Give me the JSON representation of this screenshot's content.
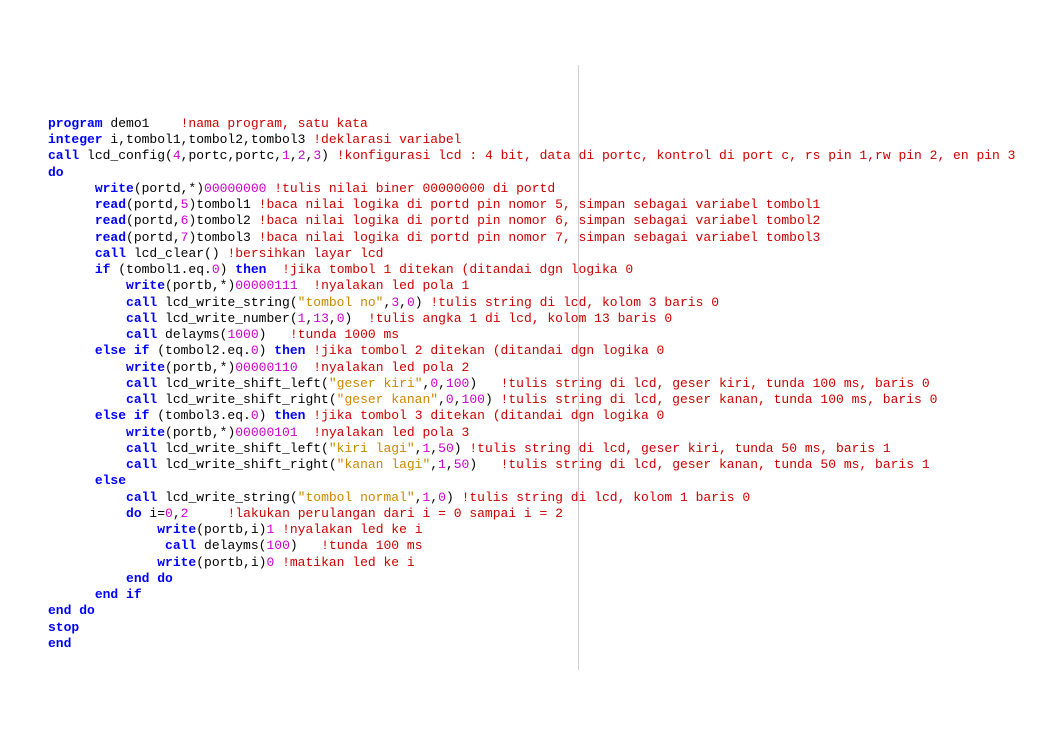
{
  "code": {
    "lines": [
      {
        "indent": 0,
        "tokens": [
          {
            "t": "kw",
            "v": "program"
          },
          {
            "t": "id",
            "v": " demo1    "
          },
          {
            "t": "cm",
            "v": "!nama program, satu kata"
          }
        ]
      },
      {
        "indent": 0,
        "tokens": [
          {
            "t": "kw",
            "v": "integer"
          },
          {
            "t": "id",
            "v": " i,tombol1,tombol2,tombol3 "
          },
          {
            "t": "cm",
            "v": "!deklarasi variabel"
          }
        ]
      },
      {
        "indent": 0,
        "tokens": [
          {
            "t": "kw",
            "v": "call"
          },
          {
            "t": "id",
            "v": " lcd_config("
          },
          {
            "t": "nm",
            "v": "4"
          },
          {
            "t": "id",
            "v": ",portc,portc,"
          },
          {
            "t": "nm",
            "v": "1"
          },
          {
            "t": "id",
            "v": ","
          },
          {
            "t": "nm",
            "v": "2"
          },
          {
            "t": "id",
            "v": ","
          },
          {
            "t": "nm",
            "v": "3"
          },
          {
            "t": "id",
            "v": ") "
          },
          {
            "t": "cm",
            "v": "!konfigurasi lcd : 4 bit, data di portc, kontrol di port c, rs pin 1,rw pin 2, en pin 3"
          }
        ]
      },
      {
        "indent": 0,
        "tokens": [
          {
            "t": "kw",
            "v": "do"
          }
        ]
      },
      {
        "indent": 6,
        "tokens": [
          {
            "t": "kw",
            "v": "write"
          },
          {
            "t": "id",
            "v": "(portd,*)"
          },
          {
            "t": "nm",
            "v": "00000000"
          },
          {
            "t": "id",
            "v": " "
          },
          {
            "t": "cm",
            "v": "!tulis nilai biner 00000000 di portd"
          }
        ]
      },
      {
        "indent": 6,
        "tokens": [
          {
            "t": "kw",
            "v": "read"
          },
          {
            "t": "id",
            "v": "(portd,"
          },
          {
            "t": "nm",
            "v": "5"
          },
          {
            "t": "id",
            "v": ")tombol1 "
          },
          {
            "t": "cm",
            "v": "!baca nilai logika di portd pin nomor 5, simpan sebagai variabel tombol1"
          }
        ]
      },
      {
        "indent": 6,
        "tokens": [
          {
            "t": "kw",
            "v": "read"
          },
          {
            "t": "id",
            "v": "(portd,"
          },
          {
            "t": "nm",
            "v": "6"
          },
          {
            "t": "id",
            "v": ")tombol2 "
          },
          {
            "t": "cm",
            "v": "!baca nilai logika di portd pin nomor 6, simpan sebagai variabel tombol2"
          }
        ]
      },
      {
        "indent": 6,
        "tokens": [
          {
            "t": "kw",
            "v": "read"
          },
          {
            "t": "id",
            "v": "(portd,"
          },
          {
            "t": "nm",
            "v": "7"
          },
          {
            "t": "id",
            "v": ")tombol3 "
          },
          {
            "t": "cm",
            "v": "!baca nilai logika di portd pin nomor 7, simpan sebagai variabel tombol3"
          }
        ]
      },
      {
        "indent": 6,
        "tokens": [
          {
            "t": "kw",
            "v": "call"
          },
          {
            "t": "id",
            "v": " lcd_clear() "
          },
          {
            "t": "cm",
            "v": "!bersihkan layar lcd"
          }
        ]
      },
      {
        "indent": 6,
        "tokens": [
          {
            "t": "kw",
            "v": "if"
          },
          {
            "t": "id",
            "v": " (tombol1.eq."
          },
          {
            "t": "nm",
            "v": "0"
          },
          {
            "t": "id",
            "v": ") "
          },
          {
            "t": "kw",
            "v": "then"
          },
          {
            "t": "id",
            "v": "  "
          },
          {
            "t": "cm",
            "v": "!jika tombol 1 ditekan (ditandai dgn logika 0"
          }
        ]
      },
      {
        "indent": 10,
        "tokens": [
          {
            "t": "kw",
            "v": "write"
          },
          {
            "t": "id",
            "v": "(portb,*)"
          },
          {
            "t": "nm",
            "v": "00000111"
          },
          {
            "t": "id",
            "v": "  "
          },
          {
            "t": "cm",
            "v": "!nyalakan led pola 1"
          }
        ]
      },
      {
        "indent": 10,
        "tokens": [
          {
            "t": "kw",
            "v": "call"
          },
          {
            "t": "id",
            "v": " lcd_write_string("
          },
          {
            "t": "st",
            "v": "\"tombol no\""
          },
          {
            "t": "id",
            "v": ","
          },
          {
            "t": "nm",
            "v": "3"
          },
          {
            "t": "id",
            "v": ","
          },
          {
            "t": "nm",
            "v": "0"
          },
          {
            "t": "id",
            "v": ") "
          },
          {
            "t": "cm",
            "v": "!tulis string di lcd, kolom 3 baris 0"
          }
        ]
      },
      {
        "indent": 10,
        "tokens": [
          {
            "t": "kw",
            "v": "call"
          },
          {
            "t": "id",
            "v": " lcd_write_number("
          },
          {
            "t": "nm",
            "v": "1"
          },
          {
            "t": "id",
            "v": ","
          },
          {
            "t": "nm",
            "v": "13"
          },
          {
            "t": "id",
            "v": ","
          },
          {
            "t": "nm",
            "v": "0"
          },
          {
            "t": "id",
            "v": ")  "
          },
          {
            "t": "cm",
            "v": "!tulis angka 1 di lcd, kolom 13 baris 0"
          }
        ]
      },
      {
        "indent": 10,
        "tokens": [
          {
            "t": "kw",
            "v": "call"
          },
          {
            "t": "id",
            "v": " delayms("
          },
          {
            "t": "nm",
            "v": "1000"
          },
          {
            "t": "id",
            "v": ")   "
          },
          {
            "t": "cm",
            "v": "!tunda 1000 ms"
          }
        ]
      },
      {
        "indent": 6,
        "tokens": [
          {
            "t": "kw",
            "v": "else if"
          },
          {
            "t": "id",
            "v": " (tombol2.eq."
          },
          {
            "t": "nm",
            "v": "0"
          },
          {
            "t": "id",
            "v": ") "
          },
          {
            "t": "kw",
            "v": "then"
          },
          {
            "t": "id",
            "v": " "
          },
          {
            "t": "cm",
            "v": "!jika tombol 2 ditekan (ditandai dgn logika 0"
          }
        ]
      },
      {
        "indent": 10,
        "tokens": [
          {
            "t": "kw",
            "v": "write"
          },
          {
            "t": "id",
            "v": "(portb,*)"
          },
          {
            "t": "nm",
            "v": "00000110"
          },
          {
            "t": "id",
            "v": "  "
          },
          {
            "t": "cm",
            "v": "!nyalakan led pola 2"
          }
        ]
      },
      {
        "indent": 10,
        "tokens": [
          {
            "t": "kw",
            "v": "call"
          },
          {
            "t": "id",
            "v": " lcd_write_shift_left("
          },
          {
            "t": "st",
            "v": "\"geser kiri\""
          },
          {
            "t": "id",
            "v": ","
          },
          {
            "t": "nm",
            "v": "0"
          },
          {
            "t": "id",
            "v": ","
          },
          {
            "t": "nm",
            "v": "100"
          },
          {
            "t": "id",
            "v": ")   "
          },
          {
            "t": "cm",
            "v": "!tulis string di lcd, geser kiri, tunda 100 ms, baris 0"
          }
        ]
      },
      {
        "indent": 10,
        "tokens": [
          {
            "t": "kw",
            "v": "call"
          },
          {
            "t": "id",
            "v": " lcd_write_shift_right("
          },
          {
            "t": "st",
            "v": "\"geser kanan\""
          },
          {
            "t": "id",
            "v": ","
          },
          {
            "t": "nm",
            "v": "0"
          },
          {
            "t": "id",
            "v": ","
          },
          {
            "t": "nm",
            "v": "100"
          },
          {
            "t": "id",
            "v": ") "
          },
          {
            "t": "cm",
            "v": "!tulis string di lcd, geser kanan, tunda 100 ms, baris 0"
          }
        ]
      },
      {
        "indent": 6,
        "tokens": [
          {
            "t": "kw",
            "v": "else if"
          },
          {
            "t": "id",
            "v": " (tombol3.eq."
          },
          {
            "t": "nm",
            "v": "0"
          },
          {
            "t": "id",
            "v": ") "
          },
          {
            "t": "kw",
            "v": "then"
          },
          {
            "t": "id",
            "v": " "
          },
          {
            "t": "cm",
            "v": "!jika tombol 3 ditekan (ditandai dgn logika 0"
          }
        ]
      },
      {
        "indent": 10,
        "tokens": [
          {
            "t": "kw",
            "v": "write"
          },
          {
            "t": "id",
            "v": "(portb,*)"
          },
          {
            "t": "nm",
            "v": "00000101"
          },
          {
            "t": "id",
            "v": "  "
          },
          {
            "t": "cm",
            "v": "!nyalakan led pola 3"
          }
        ]
      },
      {
        "indent": 10,
        "tokens": [
          {
            "t": "kw",
            "v": "call"
          },
          {
            "t": "id",
            "v": " lcd_write_shift_left("
          },
          {
            "t": "st",
            "v": "\"kiri lagi\""
          },
          {
            "t": "id",
            "v": ","
          },
          {
            "t": "nm",
            "v": "1"
          },
          {
            "t": "id",
            "v": ","
          },
          {
            "t": "nm",
            "v": "50"
          },
          {
            "t": "id",
            "v": ") "
          },
          {
            "t": "cm",
            "v": "!tulis string di lcd, geser kiri, tunda 50 ms, baris 1"
          }
        ]
      },
      {
        "indent": 10,
        "tokens": [
          {
            "t": "kw",
            "v": "call"
          },
          {
            "t": "id",
            "v": " lcd_write_shift_right("
          },
          {
            "t": "st",
            "v": "\"kanan lagi\""
          },
          {
            "t": "id",
            "v": ","
          },
          {
            "t": "nm",
            "v": "1"
          },
          {
            "t": "id",
            "v": ","
          },
          {
            "t": "nm",
            "v": "50"
          },
          {
            "t": "id",
            "v": ")   "
          },
          {
            "t": "cm",
            "v": "!tulis string di lcd, geser kanan, tunda 50 ms, baris 1"
          }
        ]
      },
      {
        "indent": 6,
        "tokens": [
          {
            "t": "kw",
            "v": "else"
          }
        ]
      },
      {
        "indent": 10,
        "tokens": [
          {
            "t": "kw",
            "v": "call"
          },
          {
            "t": "id",
            "v": " lcd_write_string("
          },
          {
            "t": "st",
            "v": "\"tombol normal\""
          },
          {
            "t": "id",
            "v": ","
          },
          {
            "t": "nm",
            "v": "1"
          },
          {
            "t": "id",
            "v": ","
          },
          {
            "t": "nm",
            "v": "0"
          },
          {
            "t": "id",
            "v": ") "
          },
          {
            "t": "cm",
            "v": "!tulis string di lcd, kolom 1 baris 0"
          }
        ]
      },
      {
        "indent": 10,
        "tokens": [
          {
            "t": "kw",
            "v": "do"
          },
          {
            "t": "id",
            "v": " i="
          },
          {
            "t": "nm",
            "v": "0"
          },
          {
            "t": "id",
            "v": ","
          },
          {
            "t": "nm",
            "v": "2"
          },
          {
            "t": "id",
            "v": "     "
          },
          {
            "t": "cm",
            "v": "!lakukan perulangan dari i = 0 sampai i = 2"
          }
        ]
      },
      {
        "indent": 14,
        "tokens": [
          {
            "t": "kw",
            "v": "write"
          },
          {
            "t": "id",
            "v": "(portb,i)"
          },
          {
            "t": "nm",
            "v": "1"
          },
          {
            "t": "id",
            "v": " "
          },
          {
            "t": "cm",
            "v": "!nyalakan led ke i"
          }
        ]
      },
      {
        "indent": 15,
        "tokens": [
          {
            "t": "kw",
            "v": "call"
          },
          {
            "t": "id",
            "v": " delayms("
          },
          {
            "t": "nm",
            "v": "100"
          },
          {
            "t": "id",
            "v": ")   "
          },
          {
            "t": "cm",
            "v": "!tunda 100 ms"
          }
        ]
      },
      {
        "indent": 14,
        "tokens": [
          {
            "t": "kw",
            "v": "write"
          },
          {
            "t": "id",
            "v": "(portb,i)"
          },
          {
            "t": "nm",
            "v": "0"
          },
          {
            "t": "id",
            "v": " "
          },
          {
            "t": "cm",
            "v": "!matikan led ke i"
          }
        ]
      },
      {
        "indent": 10,
        "tokens": [
          {
            "t": "kw",
            "v": "end do"
          }
        ]
      },
      {
        "indent": 6,
        "tokens": [
          {
            "t": "kw",
            "v": "end if"
          }
        ]
      },
      {
        "indent": 0,
        "tokens": [
          {
            "t": "kw",
            "v": "end do"
          }
        ]
      },
      {
        "indent": 0,
        "tokens": [
          {
            "t": "kw",
            "v": "stop"
          }
        ]
      },
      {
        "indent": 0,
        "tokens": [
          {
            "t": "kw",
            "v": "end"
          }
        ]
      }
    ]
  }
}
